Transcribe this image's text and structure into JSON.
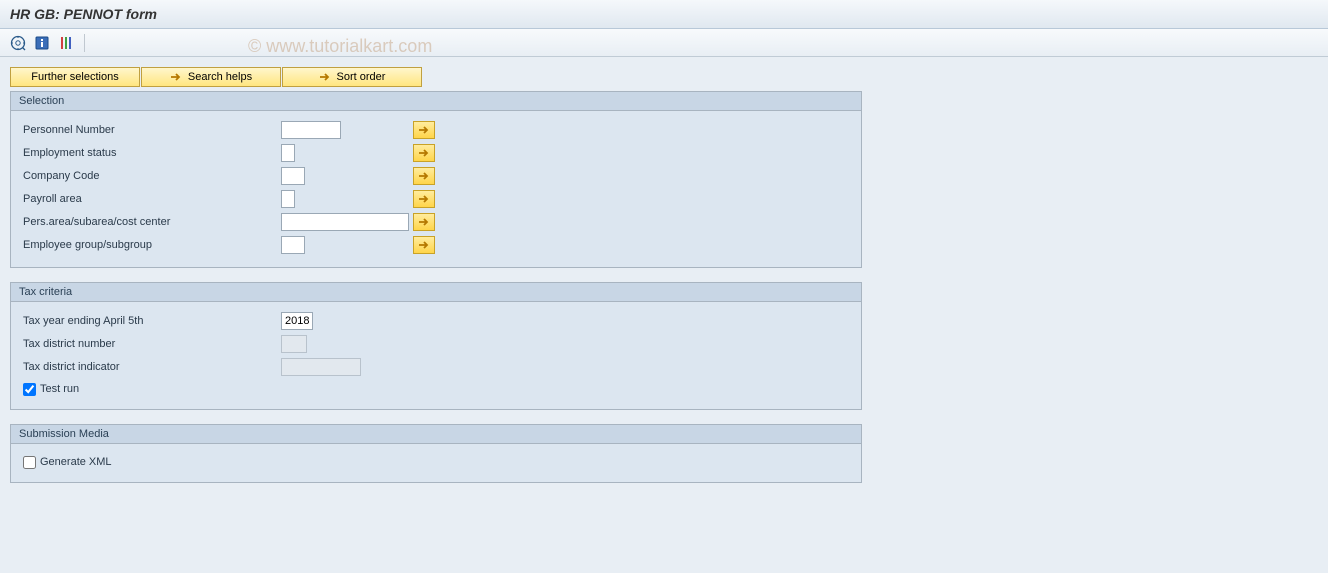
{
  "title": "HR GB: PENNOT form",
  "watermark": "© www.tutorialkart.com",
  "toolbar": {
    "execute_icon": "execute-icon",
    "info_icon": "info-icon",
    "variant_icon": "variant-icon"
  },
  "buttons": {
    "further_selections": "Further selections",
    "search_helps": "Search helps",
    "sort_order": "Sort order"
  },
  "panels": {
    "selection": {
      "title": "Selection",
      "fields": {
        "personnel_number": {
          "label": "Personnel Number",
          "value": ""
        },
        "employment_status": {
          "label": "Employment status",
          "value": ""
        },
        "company_code": {
          "label": "Company Code",
          "value": ""
        },
        "payroll_area": {
          "label": "Payroll area",
          "value": ""
        },
        "pers_area": {
          "label": "Pers.area/subarea/cost center",
          "value": ""
        },
        "employee_group": {
          "label": "Employee group/subgroup",
          "value": ""
        }
      }
    },
    "tax_criteria": {
      "title": "Tax criteria",
      "fields": {
        "tax_year": {
          "label": "Tax year ending April 5th",
          "value": "2018"
        },
        "tax_district_number": {
          "label": "Tax district number",
          "value": ""
        },
        "tax_district_indicator": {
          "label": "Tax district indicator",
          "value": ""
        },
        "test_run": {
          "label": "Test run",
          "checked": true
        }
      }
    },
    "submission_media": {
      "title": "Submission Media",
      "fields": {
        "generate_xml": {
          "label": "Generate XML",
          "checked": false
        }
      }
    }
  }
}
